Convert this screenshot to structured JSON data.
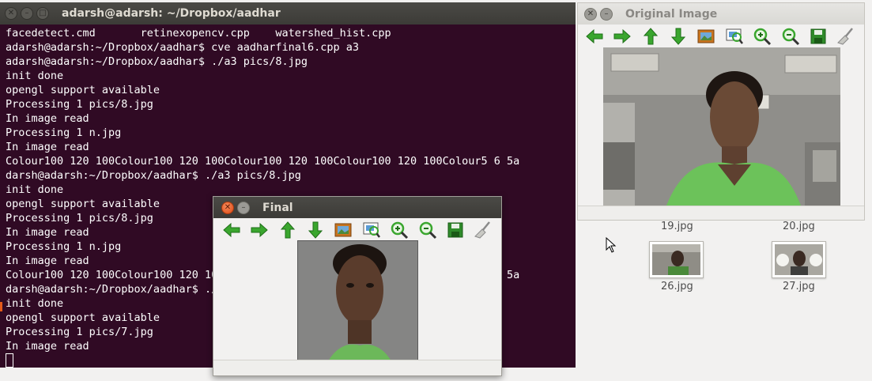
{
  "terminal": {
    "title": "adarsh@adarsh: ~/Dropbox/aadhar",
    "lines": [
      "facedetect.cmd       retinexopencv.cpp    watershed_hist.cpp",
      "adarsh@adarsh:~/Dropbox/aadhar$ cve aadharfinal6.cpp a3",
      "adarsh@adarsh:~/Dropbox/aadhar$ ./a3 pics/8.jpg",
      "init done",
      "opengl support available",
      "Processing 1 pics/8.jpg",
      "In image read",
      "Processing 1 n.jpg",
      "In image read",
      "Colour100 120 100Colour100 120 100Colour100 120 100Colour100 120 100Colour5 6 5a",
      "darsh@adarsh:~/Dropbox/aadhar$ ./a3 pics/8.jpg",
      "init done",
      "opengl support available",
      "Processing 1 pics/8.jpg",
      "In image read",
      "Processing 1 n.jpg",
      "In image read",
      "Colour100 120 100Colour100 120 100Colour100 120 100Colour100 120 100Colour5 6 5a",
      "darsh@adarsh:~/Dropbox/aadhar$ ./a3 pics/8.jpg",
      "init done",
      "opengl support available",
      "Processing 1 pics/7.jpg",
      "In image read"
    ]
  },
  "original_window": {
    "title": "Original Image"
  },
  "final_window": {
    "title": "Final"
  },
  "toolbar_icons": [
    "arrow-left-icon",
    "arrow-right-icon",
    "arrow-up-icon",
    "arrow-down-icon",
    "image-icon",
    "zoom-fit-icon",
    "zoom-in-icon",
    "zoom-out-icon",
    "save-icon",
    "clear-brush-icon"
  ],
  "file_manager": {
    "files": [
      "19.jpg",
      "20.jpg",
      "26.jpg",
      "27.jpg"
    ]
  },
  "colors": {
    "terminal_bg": "#300a24",
    "close_button": "#df4a16",
    "toolbar_arrow": "#3aa62e"
  }
}
